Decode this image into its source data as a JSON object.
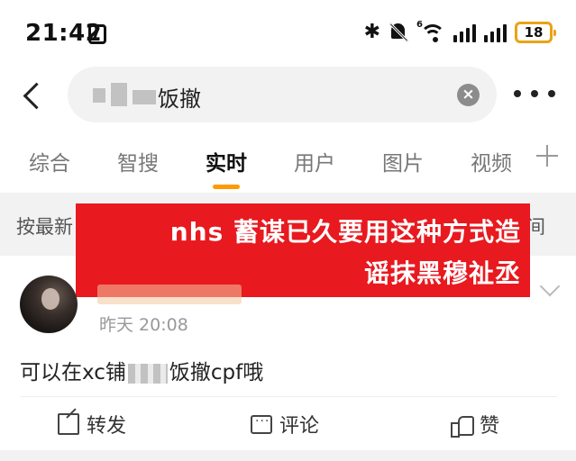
{
  "status_bar": {
    "time": "21:42",
    "battery": "18",
    "icons": [
      "nfc-icon",
      "bluetooth-icon",
      "mute-icon",
      "wifi-6-icon",
      "signal-icon",
      "signal-icon",
      "battery-icon"
    ]
  },
  "header": {
    "search_query": "饭撤",
    "clear_glyph": "×"
  },
  "tabs": [
    {
      "label": "综合"
    },
    {
      "label": "智搜"
    },
    {
      "label": "实时"
    },
    {
      "label": "用户"
    },
    {
      "label": "图片"
    },
    {
      "label": "视频"
    }
  ],
  "active_tab": "实时",
  "filter_bar": {
    "left_label": "按最新",
    "right_label": "间"
  },
  "overlay_caption": {
    "line1": "nhs 蓄谋已久要用这种方式造",
    "line2": "谣抹黑穆祉丞"
  },
  "post": {
    "time": "昨天 20:08",
    "text_before": "可以在xc铺",
    "text_after": "饭撤cpf哦"
  },
  "actions": {
    "share": "转发",
    "comment": "评论",
    "like": "赞"
  },
  "colors": {
    "accent": "#ff9a00",
    "overlay": "#e8191f",
    "battery": "#e8a316"
  }
}
